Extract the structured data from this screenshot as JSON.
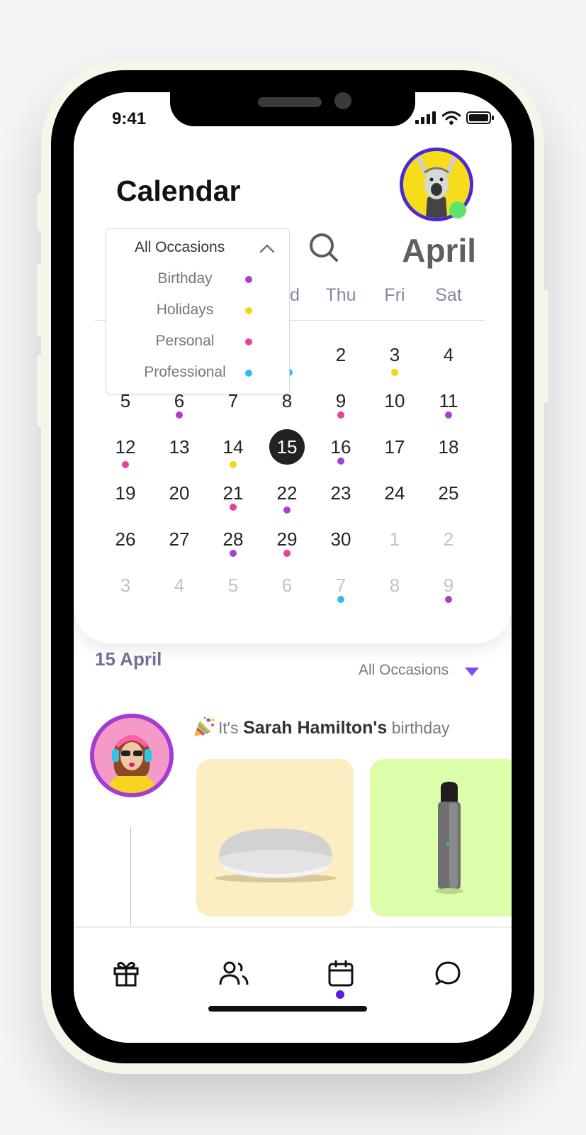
{
  "status_bar": {
    "time": "9:41"
  },
  "header": {
    "title": "Calendar",
    "month": "April"
  },
  "weekdays": [
    "ed",
    "Thu",
    "Fri",
    "Sat"
  ],
  "calendar_days": [
    [
      "2",
      "3",
      "4"
    ],
    [
      "5",
      "6",
      "7",
      "8",
      "9",
      "10",
      "11"
    ],
    [
      "12",
      "13",
      "14",
      "15",
      "16",
      "17",
      "18"
    ],
    [
      "19",
      "20",
      "21",
      "22",
      "23",
      "24",
      "25"
    ],
    [
      "26",
      "27",
      "28",
      "29",
      "30",
      "1",
      "2"
    ],
    [
      "3",
      "4",
      "5",
      "6",
      "7",
      "8",
      "9"
    ]
  ],
  "selected_day": "15",
  "occasion_filter": {
    "label": "All Occasions",
    "options": [
      {
        "label": "Birthday",
        "color": "#a83fd2"
      },
      {
        "label": "Holidays",
        "color": "#f3d712"
      },
      {
        "label": "Personal",
        "color": "#ea3f9b"
      },
      {
        "label": "Professional",
        "color": "#2ebff0"
      }
    ]
  },
  "events_section": {
    "date": "15 April",
    "filter_label": "All Occasions",
    "event": {
      "prefix": "It's",
      "name": "Sarah Hamilton's",
      "suffix": "birthday"
    }
  },
  "gift_cards": [
    {
      "color": "#fdedc3"
    },
    {
      "color": "#dcfeaa"
    }
  ],
  "tabs": [
    {
      "icon": "gift-icon"
    },
    {
      "icon": "friends-icon"
    },
    {
      "icon": "calendar-icon"
    },
    {
      "icon": "chat-icon"
    }
  ],
  "active_tab": "calendar",
  "colors": {
    "accent": "#5a1ee0",
    "birthday": "#a83fd2",
    "holiday": "#f3d712",
    "personal": "#ea3f9b",
    "professional": "#2ebff0"
  }
}
